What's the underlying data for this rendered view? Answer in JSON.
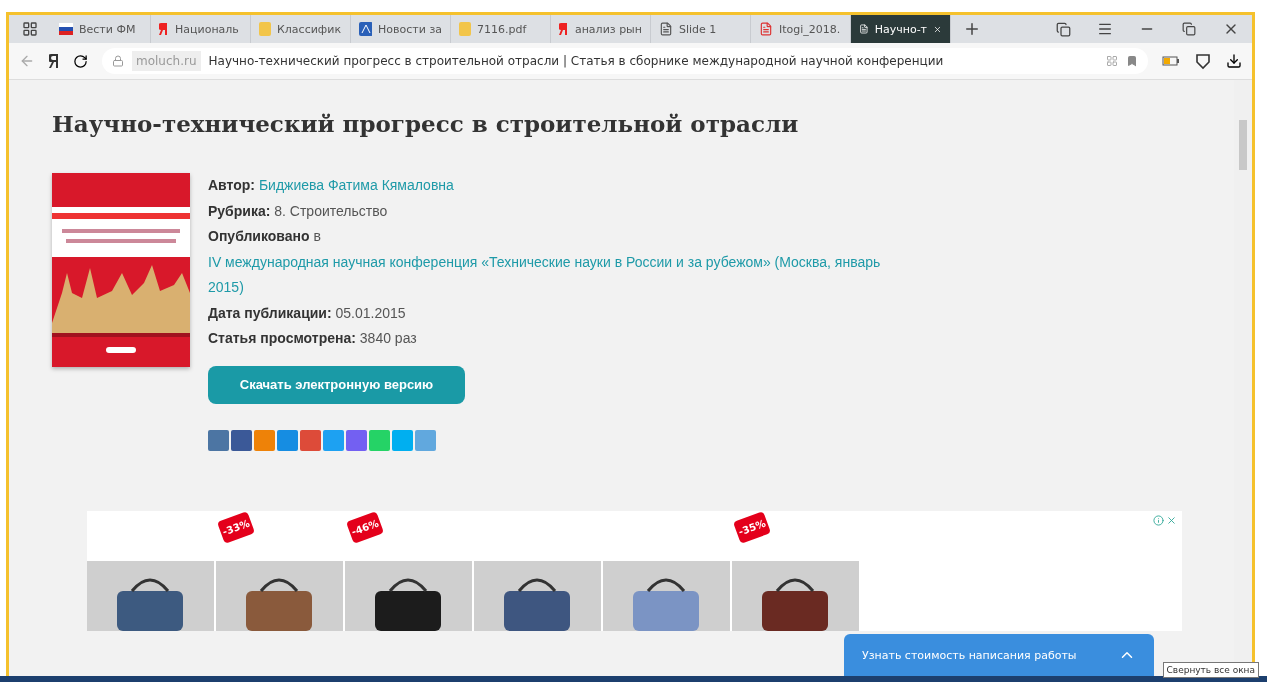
{
  "tabs": [
    {
      "label": "Вести ФМ",
      "selected": false
    },
    {
      "label": "Националь",
      "selected": false
    },
    {
      "label": "Классифик",
      "selected": false
    },
    {
      "label": "Новости за",
      "selected": false
    },
    {
      "label": "7116.pdf",
      "selected": false
    },
    {
      "label": "анализ рын",
      "selected": false
    },
    {
      "label": "Slide 1",
      "selected": false
    },
    {
      "label": "Itogi_2018.",
      "selected": false
    },
    {
      "label": "Научно-т",
      "selected": true
    }
  ],
  "address": {
    "domain": "moluch.ru",
    "title": "Научно-технический прогресс в строительной отрасли | Статья в сборнике международной научной конференции"
  },
  "article": {
    "heading": "Научно-технический прогресс в строительной отрасли",
    "meta": [
      {
        "kind": "pair",
        "label": "Автор:",
        "value": "Биджиева Фатима Кямаловна",
        "link": true
      },
      {
        "kind": "pair",
        "label": "Рубрика:",
        "value": "8. Строительство",
        "link": false
      },
      {
        "kind": "pair",
        "label": "Опубликовано",
        "value": "в",
        "link": false
      },
      {
        "kind": "line",
        "value": "IV международная научная конференция «Технические науки в России и за рубежом» (Москва, январь 2015)",
        "link": true
      },
      {
        "kind": "pair",
        "label": "Дата публикации:",
        "value": "05.01.2015",
        "link": false
      },
      {
        "kind": "pair",
        "label": "Статья просмотрена:",
        "value": "3840 раз",
        "link": false
      }
    ],
    "download": "Скачать электронную версию",
    "share": [
      {
        "color": "#4c75a3"
      },
      {
        "color": "#3b5998"
      },
      {
        "color": "#ee8208"
      },
      {
        "color": "#168de2"
      },
      {
        "color": "#dd4b39"
      },
      {
        "color": "#1da1f2"
      },
      {
        "color": "#7360f2"
      },
      {
        "color": "#25d366"
      },
      {
        "color": "#00aff0"
      },
      {
        "color": "#61a8de"
      }
    ]
  },
  "ad": {
    "products": [
      {
        "kind": "plain"
      },
      {
        "kind": "sale",
        "discount": "-33%"
      },
      {
        "kind": "sale",
        "discount": "-46%"
      },
      {
        "kind": "plain"
      },
      {
        "kind": "plain"
      },
      {
        "kind": "sale",
        "discount": "-35%"
      }
    ]
  },
  "chat": {
    "label": "Узнать стоимость написания работы"
  },
  "tooltip": "Свернуть все окна"
}
